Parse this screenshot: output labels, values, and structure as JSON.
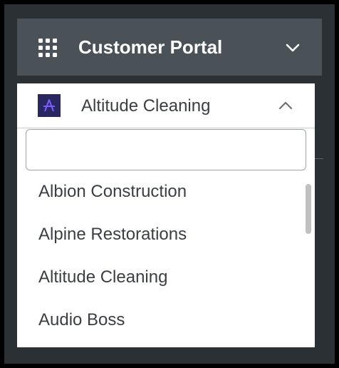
{
  "header": {
    "title": "Customer Portal",
    "grid_icon": "apps-grid-icon",
    "chevron_icon": "chevron-down-icon"
  },
  "company_select": {
    "selected": "Altitude Cleaning",
    "logo_icon": "company-logo-icon",
    "chevron_icon": "chevron-up-icon"
  },
  "dropdown": {
    "search_value": "",
    "options": [
      "Albion Construction",
      "Alpine Restorations",
      "Altitude Cleaning",
      "Audio Boss"
    ]
  },
  "colors": {
    "page_background": "#2b3035",
    "header_background": "#4a5258",
    "header_text": "#ffffff",
    "item_text": "#3b3f44",
    "logo_background": "#2a2660",
    "logo_accent": "#7b5cff"
  }
}
